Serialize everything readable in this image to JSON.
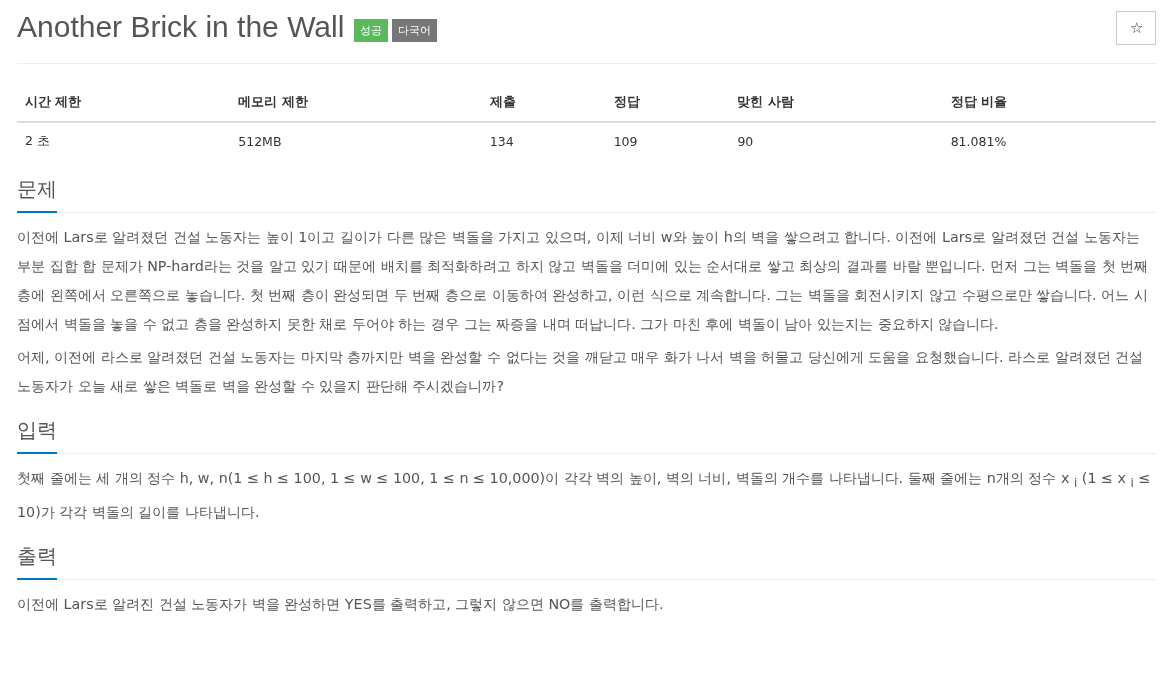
{
  "title": "Another Brick in the Wall",
  "badges": [
    {
      "label": "성공",
      "kind": "success"
    },
    {
      "label": "다국어",
      "kind": "language"
    }
  ],
  "star_button": {
    "label": "☆"
  },
  "stats_table": {
    "columns": [
      "시간 제한",
      "메모리 제한",
      "제출",
      "정답",
      "맞힌 사람",
      "정답 비율"
    ],
    "rows": [
      [
        "2 초",
        "512MB",
        "134",
        "109",
        "90",
        "81.081%"
      ]
    ]
  },
  "sections": [
    {
      "heading": "문제",
      "paragraphs": [
        "이전에 Lars로 알려졌던 건설 노동자는 높이 1이고 길이가 다른 많은 벽돌을 가지고 있으며, 이제 너비 w와 높이 h의 벽을 쌓으려고 합니다. 이전에 Lars로 알려졌던 건설 노동자는 부분 집합 합 문제가 NP-hard라는 것을 알고 있기 때문에 배치를 최적화하려고 하지 않고 벽돌을 더미에 있는 순서대로 쌓고 최상의 결과를 바랄 뿐입니다. 먼저 그는 벽돌을 첫 번째 층에 왼쪽에서 오른쪽으로 놓습니다. 첫 번째 층이 완성되면 두 번째 층으로 이동하여 완성하고, 이런 식으로 계속합니다. 그는 벽돌을 회전시키지 않고 수평으로만 쌓습니다. 어느 시점에서 벽돌을 놓을 수 없고 층을 완성하지 못한 채로 두어야 하는 경우 그는 짜증을 내며 떠납니다. 그가 마친 후에 벽돌이 남아 있는지는 중요하지 않습니다.",
        "어제, 이전에 라스로 알려졌던 건설 노동자는 마지막 층까지만 벽을 완성할 수 없다는 것을 깨닫고 매우 화가 나서 벽을 허물고 당신에게 도움을 요청했습니다. 라스로 알려졌던 건설 노동자가 오늘 새로 쌓은 벽돌로 벽을 완성할 수 있을지 판단해 주시겠습니까?"
      ]
    },
    {
      "heading": "입력",
      "paragraphs": [
        "첫째 줄에는 세 개의 정수 h, w, n(1 ≤ h ≤ 100, 1 ≤ w ≤ 100, 1 ≤ n ≤ 10,000)이 각각 벽의 높이, 벽의 너비, 벽돌의 개수를 나타냅니다. 둘째 줄에는 n개의 정수 x $_{i}$ (1 ≤ x $_{i}$ ≤ 10)가 각각 벽돌의 길이를 나타냅니다."
      ]
    },
    {
      "heading": "출력",
      "paragraphs": [
        "이전에 Lars로 알려진 건설 노동자가 벽을 완성하면 YES를 출력하고, 그렇지 않으면 NO를 출력합니다."
      ]
    }
  ]
}
